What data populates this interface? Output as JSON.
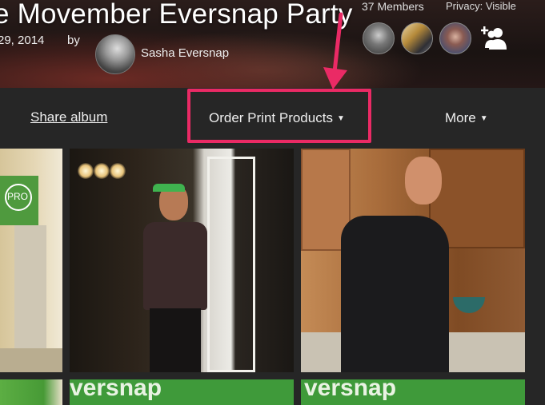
{
  "album": {
    "title": "e Movember Eversnap Party",
    "date": "29, 2014",
    "by_label": "by",
    "owner_name": "Sasha Eversnap"
  },
  "members": {
    "count_label": "37 Members",
    "privacy_label": "Privacy: Visible"
  },
  "toolbar": {
    "share_label": "Share album",
    "order_label": "Order Print Products",
    "more_label": "More"
  },
  "photos": {
    "p1_banner_text": "PRO",
    "strip_text_left": "versnap",
    "strip_text_right": "versnap"
  },
  "colors": {
    "highlight": "#ea2a65",
    "background": "#262626",
    "banner_green": "#3f9a3a"
  },
  "icons": [
    "add-member-icon",
    "arrow-down-icon",
    "caret-down-icon"
  ]
}
